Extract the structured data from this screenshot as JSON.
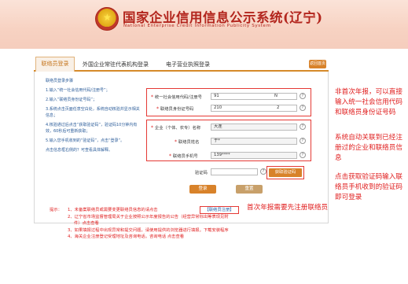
{
  "header": {
    "title": "国家企业信用信息公示系统(辽宁)",
    "subtitle": "National Enterprise Credit Information Publicity System"
  },
  "tabs": [
    {
      "label": "联络员登录"
    },
    {
      "label": "外国企业常驻代表机构登录"
    },
    {
      "label": "电子营业执照登录"
    }
  ],
  "help_button": "返回首页",
  "steps": [
    "联络员登录步骤",
    "1.输入“统一社会信用代码/注册号”；",
    "2.输入“联络员身份证号码”；",
    "3.系统点击页面任意空白处，系统自动核验并显示相关信息；",
    "4.核验通过后点击“获取验证码”，验证码10分钟内有效，60秒后可重新获取；",
    "5.输入您手机收到的“验证码”，点击“登录”。",
    "点击信息框右侧的？可查看具体解释。"
  ],
  "form": {
    "credit_code_label": "统一社会信用代码/注册号",
    "credit_code_value": "91",
    "credit_code_suffix": "N",
    "id_label": "联络员身份证号码",
    "id_value": "210",
    "id_suffix": "2",
    "company_label": "企业（个体、农专）名称",
    "company_value": "大连",
    "contact_label": "联络员姓名",
    "contact_value": "于*",
    "phone_label": "联络员手机号",
    "phone_value": "139****",
    "code_label": "验证码",
    "get_code_button": "获取验证码",
    "login_button": "登录",
    "reset_button": "重置"
  },
  "notes": {
    "note1": "非首次年报，可以直接输入统一社会信用代码和联络员身份证号码",
    "note2": "系统自动关联到已经注册过的企业和联络员信息",
    "note3": "点击获取验证码输入联络员手机收到的验证码即可登录",
    "note4": "首次年报需要先注册联络员"
  },
  "tips": {
    "prefix": "提示：",
    "line1": "1、未备案联络员或需要变更联络员信息的请点击",
    "register_link": "【联络员注册】",
    "line2": "2、辽宁省市场监督管理局关于企业按照公示年度报告的公告（经营异常标出等表现见附",
    "line2b": "件）点击查看",
    "line3": "3、如果填报过程中出现异常和提交问题，请使用提供的浏览器进行填报。下载安装程序",
    "line4": "4、海关企业注册登记受理地址及咨询电话。咨询电话 点击查看"
  }
}
